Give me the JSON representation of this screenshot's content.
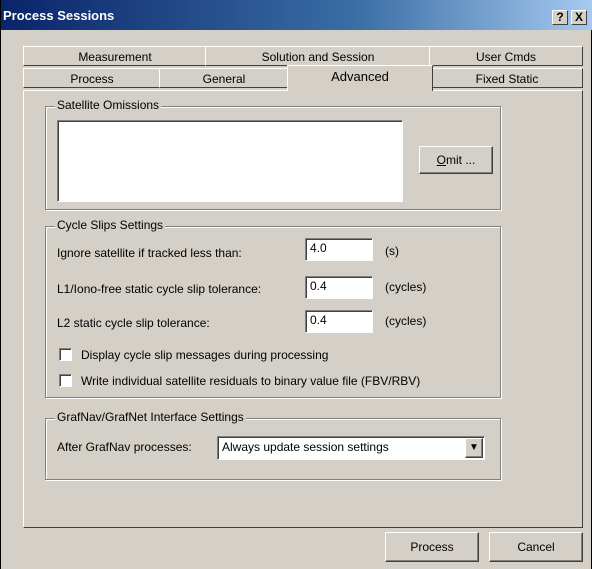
{
  "window": {
    "title": "Process Sessions",
    "help_label": "?",
    "close_label": "X"
  },
  "tabs_back": [
    {
      "label": "Measurement"
    },
    {
      "label": "Solution and Session"
    },
    {
      "label": "User Cmds"
    }
  ],
  "tabs_front": [
    {
      "label": "Process"
    },
    {
      "label": "General"
    },
    {
      "label": "Advanced",
      "active": true
    },
    {
      "label": "Fixed Static"
    }
  ],
  "satellite_omissions": {
    "group_label": "Satellite Omissions",
    "omit_prefix": "O",
    "omit_rest": "mit ..."
  },
  "cycle_slips": {
    "group_label": "Cycle Slips Settings",
    "rows": [
      {
        "label": "Ignore satellite if tracked less than:",
        "value": "4.0",
        "unit": "(s)"
      },
      {
        "label": "L1/Iono-free static cycle slip tolerance:",
        "value": "0.4",
        "unit": "(cycles)"
      },
      {
        "label": "L2 static cycle slip tolerance:",
        "value": "0.4",
        "unit": "(cycles)"
      }
    ],
    "checkboxes": [
      {
        "label": "Display cycle slip messages during processing",
        "checked": false
      },
      {
        "label": "Write individual satellite residuals to binary value file (FBV/RBV)",
        "checked": false
      }
    ]
  },
  "interface": {
    "group_label": "GrafNav/GrafNet Interface Settings",
    "after_label": "After GrafNav processes:",
    "selected": "Always update session settings",
    "dropdown_glyph": "▼"
  },
  "buttons": {
    "process_label": "Process",
    "cancel_label": "Cancel"
  },
  "colors": {
    "face": "#d4d0c8",
    "title_start": "#0a246a",
    "title_end": "#a6caf0"
  }
}
